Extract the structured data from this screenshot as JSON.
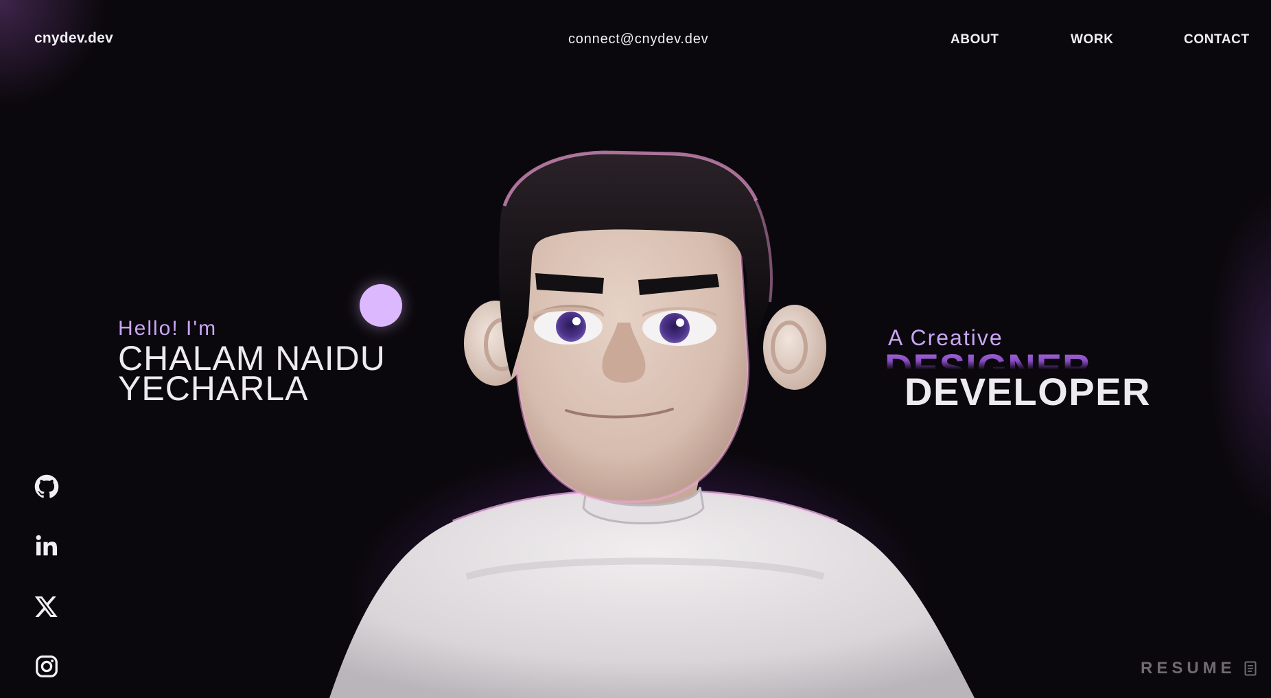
{
  "header": {
    "logo": "cnydev.dev",
    "email": "connect@cnydev.dev",
    "nav": {
      "about": "ABOUT",
      "work": "WORK",
      "contact": "CONTACT"
    }
  },
  "hero": {
    "greeting": "Hello! I'm",
    "name_line1": "CHALAM NAIDU",
    "name_line2": "YECHARLA",
    "role_intro": "A Creative",
    "role_primary": "DESIGNER",
    "role_secondary": "DEVELOPER"
  },
  "social": [
    {
      "icon": "github-icon"
    },
    {
      "icon": "linkedin-icon"
    },
    {
      "icon": "x-icon"
    },
    {
      "icon": "instagram-icon"
    }
  ],
  "resume": {
    "label": "RESUME",
    "icon": "document-icon"
  },
  "colors": {
    "background": "#0b080d",
    "accent": "#c9a6f4",
    "glow": "#9c46d2",
    "text": "#eeeaf2",
    "muted": "#6f6a74"
  }
}
